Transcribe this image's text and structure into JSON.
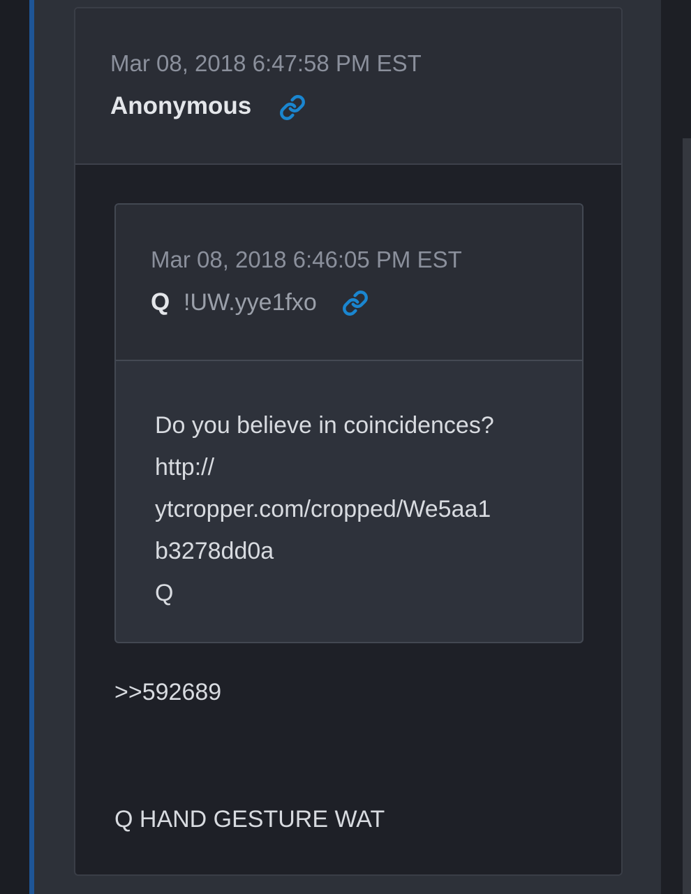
{
  "post": {
    "timestamp": "Mar 08, 2018 6:47:58 PM EST",
    "author": "Anonymous",
    "link_icon": "link-icon",
    "reply_ref": ">>592689",
    "message": "Q HAND GESTURE WAT"
  },
  "quoted_post": {
    "timestamp": "Mar 08, 2018 6:46:05 PM EST",
    "author": "Q",
    "tripcode": "!UW.yye1fxo",
    "link_icon": "link-icon",
    "body_lines": [
      "Do you believe in coincidences?",
      "http://",
      "ytcropper.com/cropped/We5aa1",
      "b3278dd0a",
      "Q"
    ]
  },
  "colors": {
    "accent_bar": "#1e5596",
    "link_icon": "#1a86d0",
    "card_background": "#1e2027",
    "header_background": "#2a2d35"
  }
}
